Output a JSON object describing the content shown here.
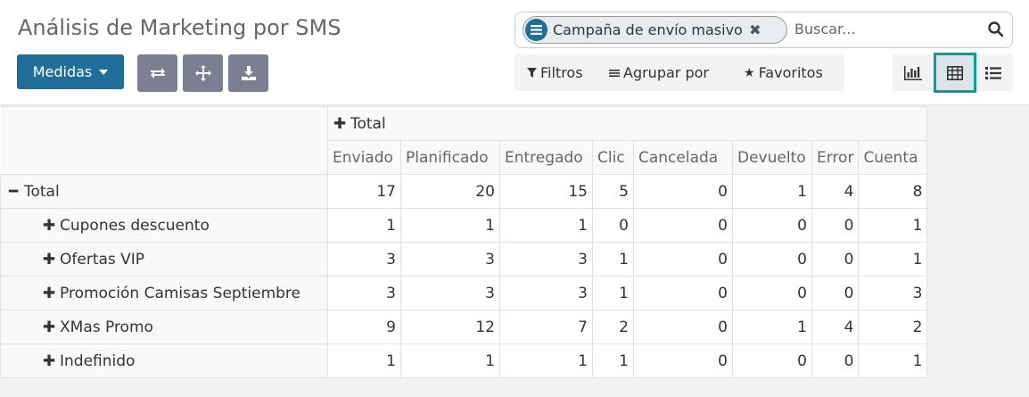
{
  "page": {
    "title": "Análisis de Marketing por SMS"
  },
  "toolbar": {
    "measures_label": "Medidas"
  },
  "search": {
    "facet_label": "Campaña de envío masivo",
    "placeholder": "Buscar..."
  },
  "filters": {
    "filters_label": "Filtros",
    "groupby_label": "Agrupar por",
    "favorites_label": "Favoritos"
  },
  "pivot": {
    "col_group": "Total",
    "columns": [
      "Enviado",
      "Planificado",
      "Entregado",
      "Clic",
      "Cancelada",
      "Devuelto",
      "Error",
      "Cuenta"
    ],
    "total_label": "Total",
    "total_values": [
      "17",
      "20",
      "15",
      "5",
      "0",
      "1",
      "4",
      "8"
    ],
    "rows": [
      {
        "label": "Cupones descuento",
        "values": [
          "1",
          "1",
          "1",
          "0",
          "0",
          "0",
          "0",
          "1"
        ]
      },
      {
        "label": "Ofertas VIP",
        "values": [
          "3",
          "3",
          "3",
          "1",
          "0",
          "0",
          "0",
          "1"
        ]
      },
      {
        "label": "Promoción Camisas Septiembre",
        "values": [
          "3",
          "3",
          "3",
          "1",
          "0",
          "0",
          "0",
          "3"
        ]
      },
      {
        "label": "XMas Promo",
        "values": [
          "9",
          "12",
          "7",
          "2",
          "0",
          "1",
          "4",
          "2"
        ]
      },
      {
        "label": "Indefinido",
        "values": [
          "1",
          "1",
          "1",
          "1",
          "0",
          "0",
          "0",
          "1"
        ]
      }
    ]
  },
  "colors": {
    "primary": "#1f6f9a",
    "secondary": "#7b7f91",
    "active_view": "#00a09d"
  },
  "icons": [
    "caret-down-icon",
    "swap-axis-icon",
    "expand-all-icon",
    "download-icon",
    "group-icon",
    "close-icon",
    "search-icon",
    "filter-icon",
    "group-by-icon",
    "star-icon",
    "graph-view-icon",
    "pivot-view-icon",
    "list-view-icon",
    "plus-icon",
    "minus-icon"
  ]
}
